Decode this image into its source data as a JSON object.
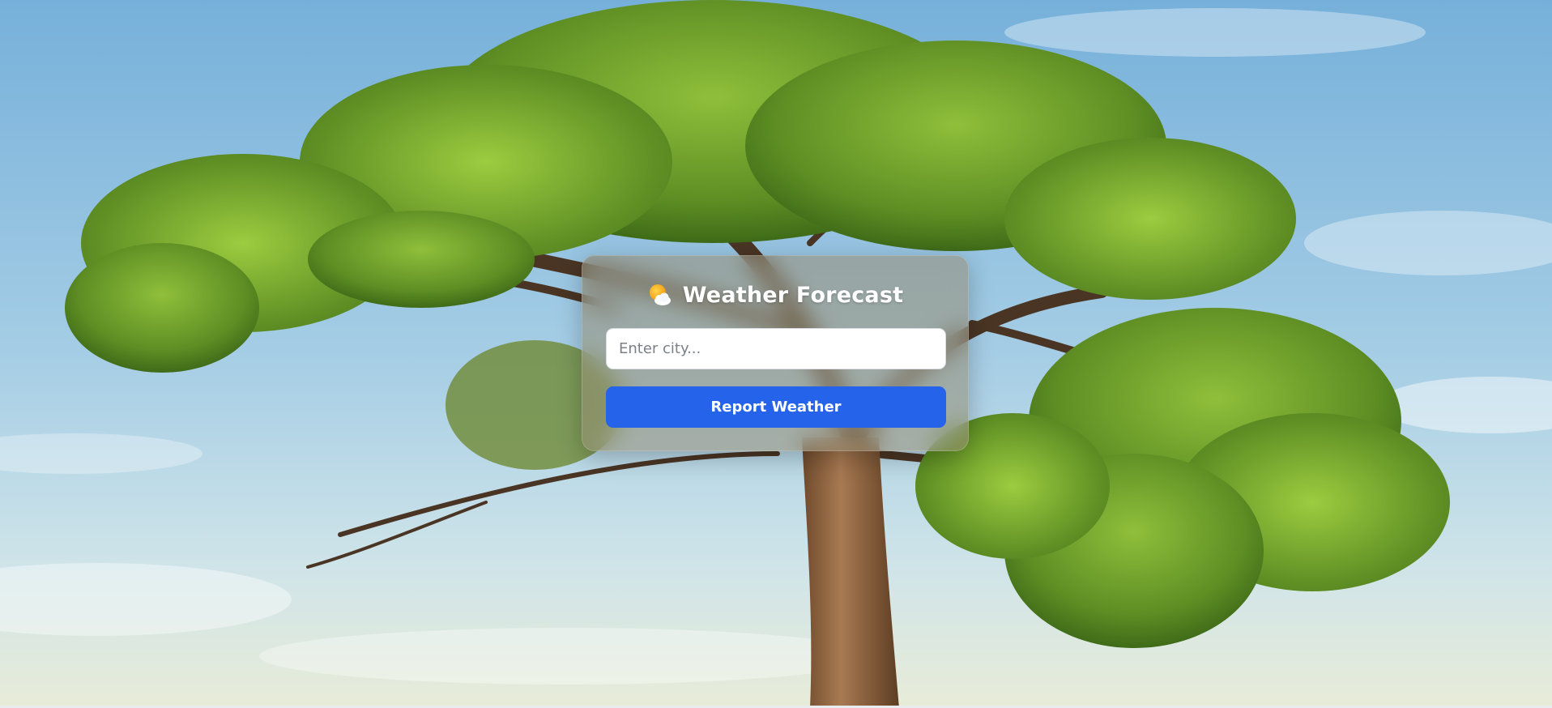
{
  "app": {
    "title": "Weather Forecast",
    "title_icon": "sun-behind-cloud-icon"
  },
  "search": {
    "placeholder": "Enter city...",
    "value": ""
  },
  "actions": {
    "report_label": "Report Weather"
  },
  "colors": {
    "button_bg": "#2563eb",
    "button_text": "#ffffff",
    "title_text": "#ffffff",
    "card_bg": "rgba(150,140,115,0.55)",
    "sky": "#8fc2e0"
  },
  "background": {
    "scene": "tree-against-sky-photo"
  }
}
